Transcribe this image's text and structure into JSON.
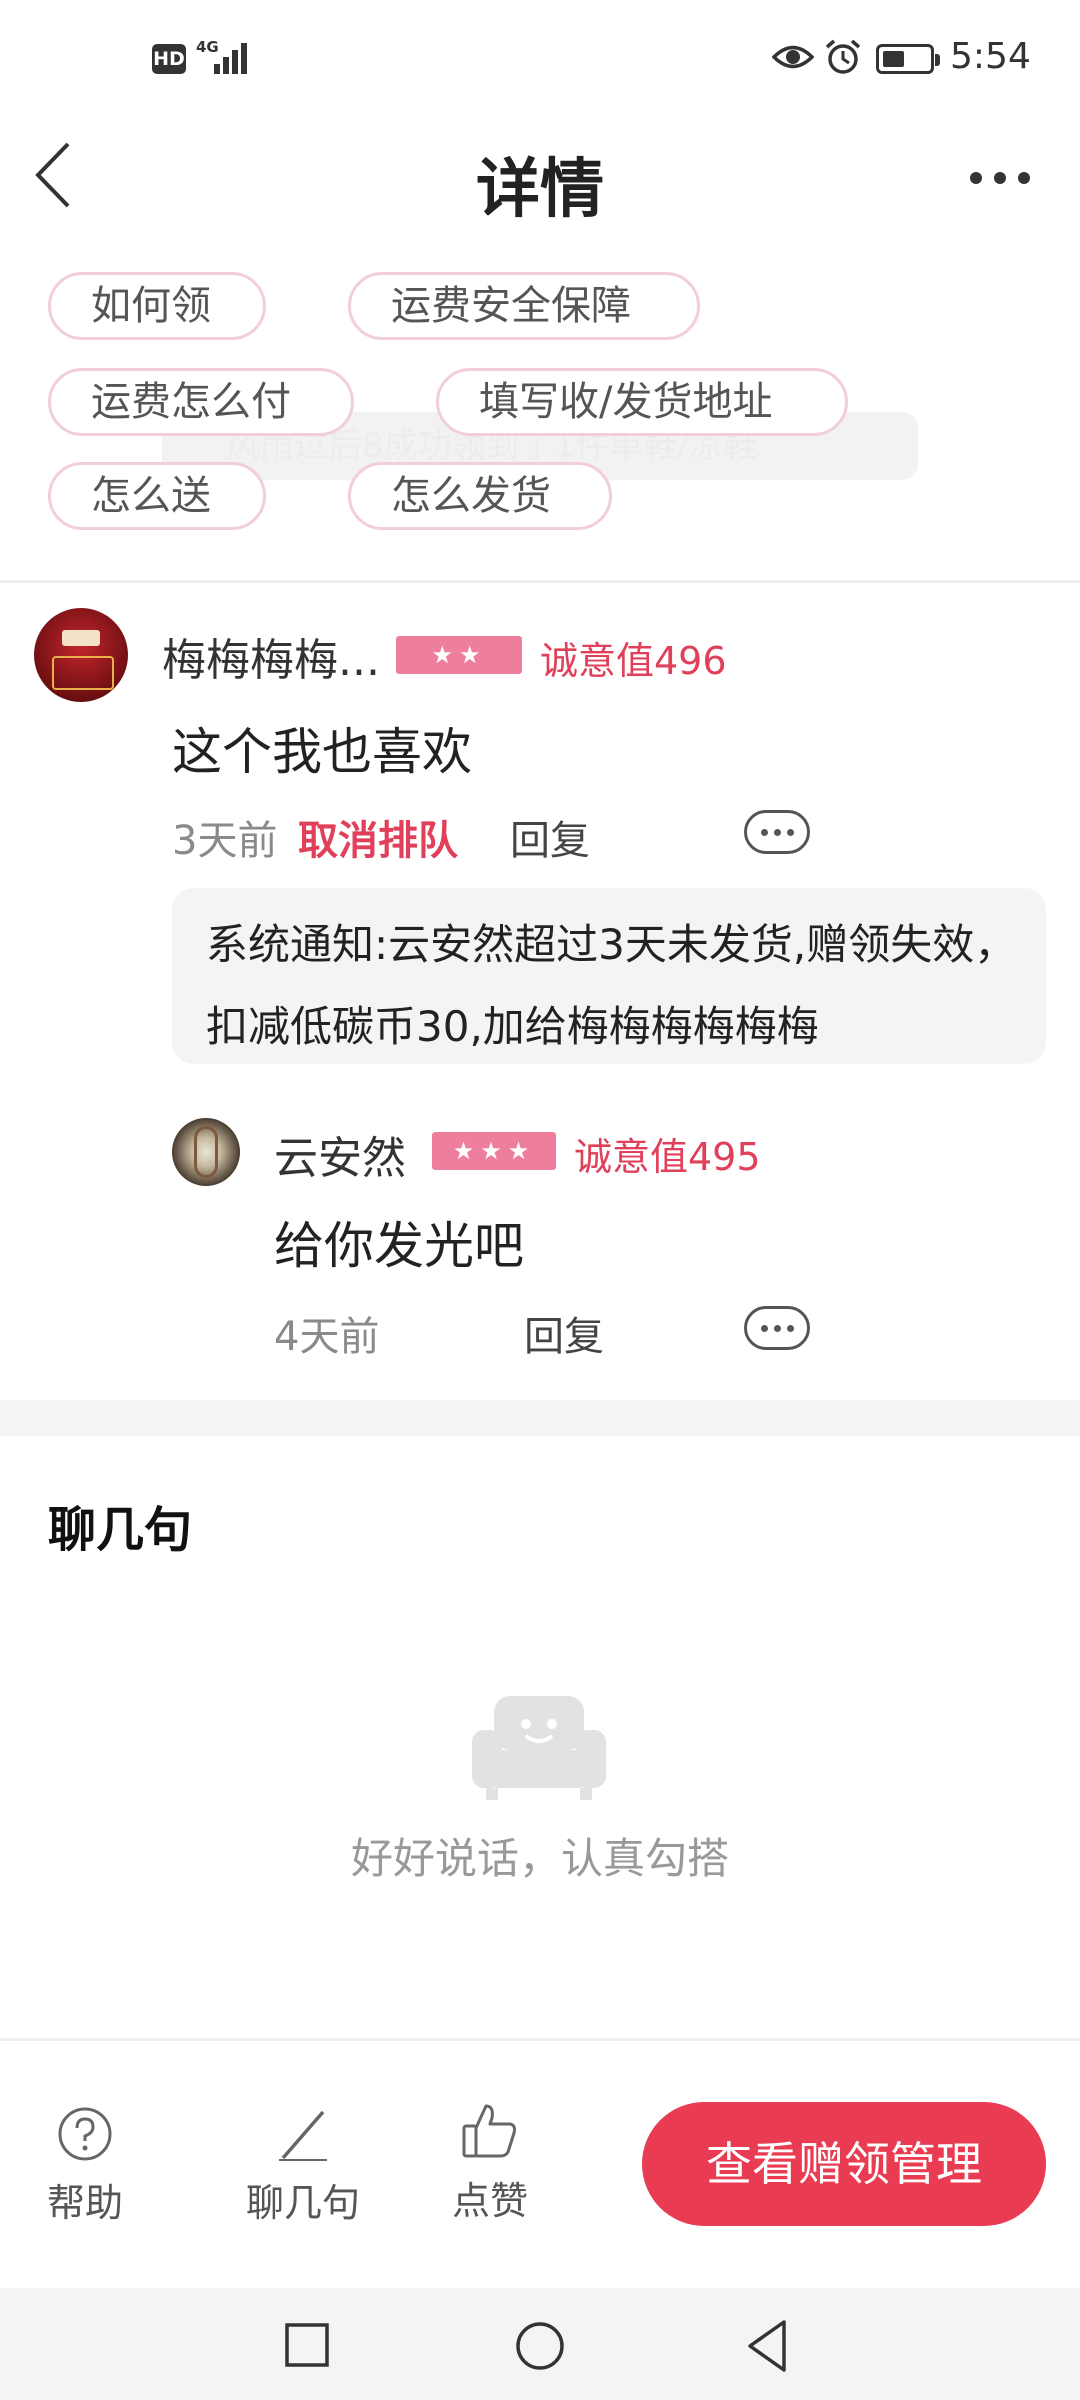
{
  "status_bar": {
    "hd": "HD",
    "network": "4G",
    "time": "5:54",
    "battery_percent": 40
  },
  "header": {
    "title": "详情"
  },
  "tags": [
    "如何领",
    "运费安全保障",
    "运费怎么付",
    "填写收/发货地址",
    "怎么送",
    "怎么发货"
  ],
  "faded_toast": "风雨过后8成功领到了1件单鞋/凉鞋",
  "comment": {
    "username": "梅梅梅梅...",
    "star_count": 2,
    "stars": "★★",
    "sincerity": "诚意值496",
    "text": "这个我也喜欢",
    "time": "3天前",
    "cancel_label": "取消排队",
    "reply_label": "回复",
    "system_notice": "系统通知:云安然超过3天未发货,赠领失效，扣减低碳币30,加给梅梅梅梅梅梅"
  },
  "reply": {
    "username": "云安然",
    "star_count": 3,
    "stars": "★★★",
    "sincerity": "诚意值495",
    "text": "给你发光吧",
    "time": "4天前",
    "reply_label": "回复"
  },
  "chat_section": {
    "title": "聊几句",
    "empty_text": "好好说话，认真勾搭"
  },
  "bottom_bar": {
    "help_label": "帮助",
    "chat_label": "聊几句",
    "like_label": "点赞",
    "cta_label": "查看赠领管理"
  }
}
